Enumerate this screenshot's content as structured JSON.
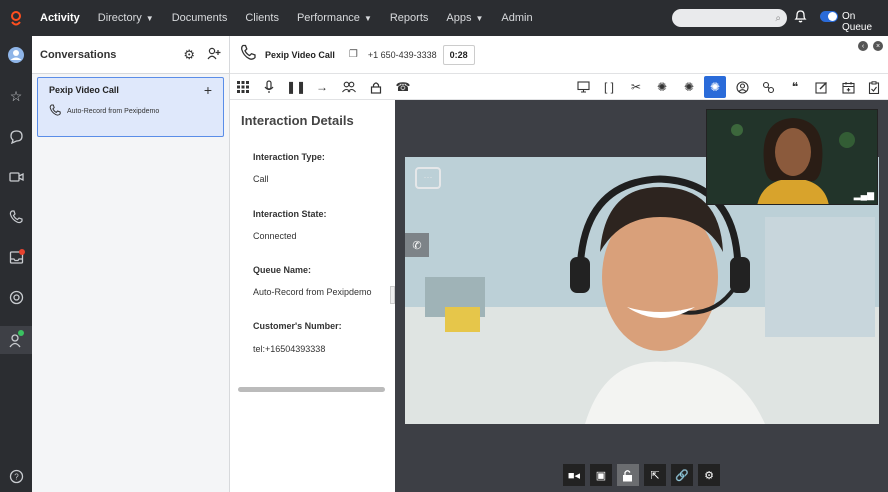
{
  "nav": {
    "items": [
      {
        "label": "Activity",
        "active": true,
        "caret": false
      },
      {
        "label": "Directory",
        "caret": true
      },
      {
        "label": "Documents",
        "caret": false
      },
      {
        "label": "Clients",
        "caret": false
      },
      {
        "label": "Performance",
        "caret": true
      },
      {
        "label": "Reports",
        "caret": false
      },
      {
        "label": "Apps",
        "caret": true
      },
      {
        "label": "Admin",
        "caret": false
      }
    ],
    "search_placeholder": "",
    "status_label": "On Queue"
  },
  "conversations": {
    "title": "Conversations",
    "card": {
      "title": "Pexip Video Call",
      "subtitle": "Auto-Record from Pexipdemo"
    }
  },
  "call": {
    "title": "Pexip Video Call",
    "number": "+1 650-439-3338",
    "timer": "0:28"
  },
  "details": {
    "title": "Interaction Details",
    "fields": [
      {
        "label": "Interaction Type:",
        "value": "Call"
      },
      {
        "label": "Interaction State:",
        "value": "Connected"
      },
      {
        "label": "Queue Name:",
        "value": "Auto-Record from Pexipdemo"
      },
      {
        "label": "Customer's Number:",
        "value": "tel:+16504393338"
      }
    ]
  },
  "colors": {
    "nav_bg": "#2b2d31",
    "accent": "#2a6bd9",
    "card_bg": "#dfe8fb"
  }
}
